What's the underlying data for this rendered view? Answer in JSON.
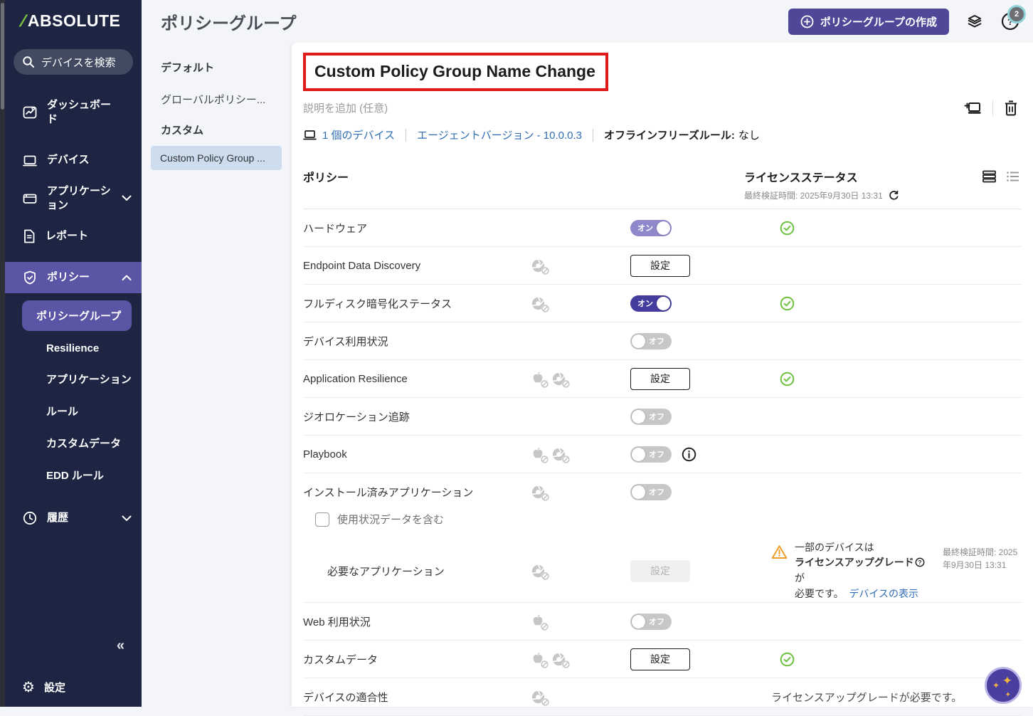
{
  "colors": {
    "sidebar_bg": "#1d2543",
    "accent_purple": "#5b55a6",
    "button_purple": "#4f4899",
    "toggle_on": "#443d9e",
    "toggle_on_light": "#8f89cb",
    "toggle_off": "#c7c7c7",
    "link_blue": "#2f6db5",
    "success_green": "#6cc13e",
    "warning_orange": "#f09d2c",
    "annotation_red": "#e01a1a",
    "selected_item_bg": "#cdddee"
  },
  "sidebar": {
    "logo_text": "ABSOLUTE",
    "search_placeholder": "デバイスを検索",
    "items": [
      {
        "label": "ダッシュボード",
        "icon": "dashboard-icon"
      },
      {
        "label": "デバイス",
        "icon": "devices-icon"
      },
      {
        "label": "アプリケーション",
        "icon": "applications-icon",
        "chevron": "down"
      },
      {
        "label": "レポート",
        "icon": "reports-icon"
      },
      {
        "label": "ポリシー",
        "icon": "policy-shield-icon",
        "chevron": "up",
        "active": true
      }
    ],
    "policy_subitems": [
      {
        "label": "ポリシーグループ",
        "active": true
      },
      {
        "label": "Resilience"
      },
      {
        "label": "アプリケーション"
      },
      {
        "label": "ルール"
      },
      {
        "label": "カスタムデータ"
      },
      {
        "label": "EDD ルール"
      }
    ],
    "history_label": "履歴",
    "collapse_label": "«",
    "settings_label": "設定"
  },
  "header": {
    "title": "ポリシーグループ",
    "create_button": "ポリシーグループの作成",
    "help_badge": "2"
  },
  "group_panel": {
    "sections": [
      {
        "heading": "デフォルト",
        "items": [
          {
            "label": "グローバルポリシー..."
          }
        ]
      },
      {
        "heading": "カスタム",
        "items": [
          {
            "label": "Custom Policy Group ...",
            "selected": true
          }
        ]
      }
    ]
  },
  "detail": {
    "name": "Custom Policy Group Name Change",
    "description_placeholder": "説明を追加 (任意)",
    "devices_link": "1 個のデバイス",
    "agent_version_link": "エージェントバージョン - 10.0.0.3",
    "offline_rule_label": "オフラインフリーズルール:",
    "offline_rule_value": "なし"
  },
  "table": {
    "policy_header": "ポリシー",
    "license_header": "ライセンスステータス",
    "last_verified": "最終検証時間: 2025年9月30日 13:31",
    "toggle_on_label": "オン",
    "toggle_off_label": "オフ",
    "config_label": "設定",
    "rows": [
      {
        "name": "ハードウェア",
        "platforms": [],
        "control": "toggle-on-light",
        "status": "ok"
      },
      {
        "name": "Endpoint Data Discovery",
        "platforms": [
          "chrome"
        ],
        "control": "config"
      },
      {
        "name": "フルディスク暗号化ステータス",
        "platforms": [
          "chrome"
        ],
        "control": "toggle-on",
        "status": "ok"
      },
      {
        "name": "デバイス利用状況",
        "platforms": [],
        "control": "toggle-off"
      },
      {
        "name": "Application Resilience",
        "platforms": [
          "mac",
          "chrome"
        ],
        "control": "config",
        "status": "ok"
      },
      {
        "name": "ジオロケーション追跡",
        "platforms": [],
        "control": "toggle-off"
      },
      {
        "name": "Playbook",
        "platforms": [
          "mac",
          "chrome"
        ],
        "control": "toggle-off",
        "info": true
      },
      {
        "name": "インストール済みアプリケーション",
        "platforms": [
          "chrome"
        ],
        "control": "toggle-off",
        "checkbox_label": "使用状況データを含む"
      },
      {
        "name": "必要なアプリケーション",
        "indent": true,
        "no_top": true,
        "platforms": [
          "chrome"
        ],
        "control": "config-disabled",
        "tall": true,
        "warning": {
          "line1": "一部のデバイスは",
          "bold": "ライセンスアップグレード",
          "suffix": "が",
          "line2": "必要です。",
          "link": "デバイスの表示",
          "timestamp": "最終検証時間: 2025年9月30日 13:31"
        }
      },
      {
        "name": "Web 利用状況",
        "platforms": [
          "mac"
        ],
        "control": "toggle-off"
      },
      {
        "name": "カスタムデータ",
        "platforms": [
          "mac",
          "chrome"
        ],
        "control": "config",
        "status": "ok"
      },
      {
        "name": "デバイスの適合性",
        "platforms": [
          "chrome"
        ],
        "status_text": "ライセンスアップグレードが必要です。"
      }
    ]
  }
}
